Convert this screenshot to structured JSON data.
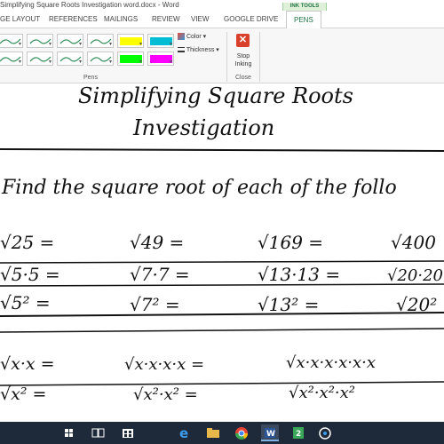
{
  "window": {
    "title": "Simplifying Square Roots Investigation word.docx - Word",
    "context_tab_group": "INK TOOLS"
  },
  "tabs": [
    {
      "label": "GE LAYOUT"
    },
    {
      "label": "REFERENCES"
    },
    {
      "label": "MAILINGS"
    },
    {
      "label": "REVIEW"
    },
    {
      "label": "VIEW"
    },
    {
      "label": "GOOGLE DRIVE"
    },
    {
      "label": "PENS"
    }
  ],
  "ribbon": {
    "pens_group_label": "Pens",
    "color_label": "Color",
    "thickness_label": "Thickness",
    "stop_inking_line1": "Stop",
    "stop_inking_line2": "Inking",
    "close_group_label": "Close",
    "pen_colors": [
      "#2e8b57",
      "#2e8b57",
      "#2e8b57",
      "#2e8b57",
      "#ffff00",
      "#00bcd4",
      "#2e8b57",
      "#2e8b57",
      "#2e8b57",
      "#2e8b57",
      "#00ff00",
      "#ff00ff"
    ]
  },
  "document": {
    "title_line1": "Simplifying Square Roots",
    "title_line2": "Investigation",
    "instruction": "Find the square root of each of the follo",
    "rows": [
      [
        "√25 =",
        "√49 =",
        "√169 =",
        "√400"
      ],
      [
        "√5·5 =",
        "√7·7 =",
        "√13·13 =",
        "√20·20"
      ],
      [
        "√5² =",
        "√7² =",
        "√13² =",
        "√20²"
      ],
      [
        "√x·x =",
        "√x·x·x·x =",
        "√x·x·x·x·x·x",
        ""
      ],
      [
        "√x² =",
        "√x²·x² =",
        "√x²·x²·x²",
        ""
      ]
    ]
  },
  "taskbar": {
    "icons": [
      "windows-icon",
      "task-view-icon",
      "store-icon",
      "edge-icon",
      "explorer-icon",
      "chrome-icon",
      "word-icon",
      "app-icon",
      "cortana-icon"
    ]
  }
}
